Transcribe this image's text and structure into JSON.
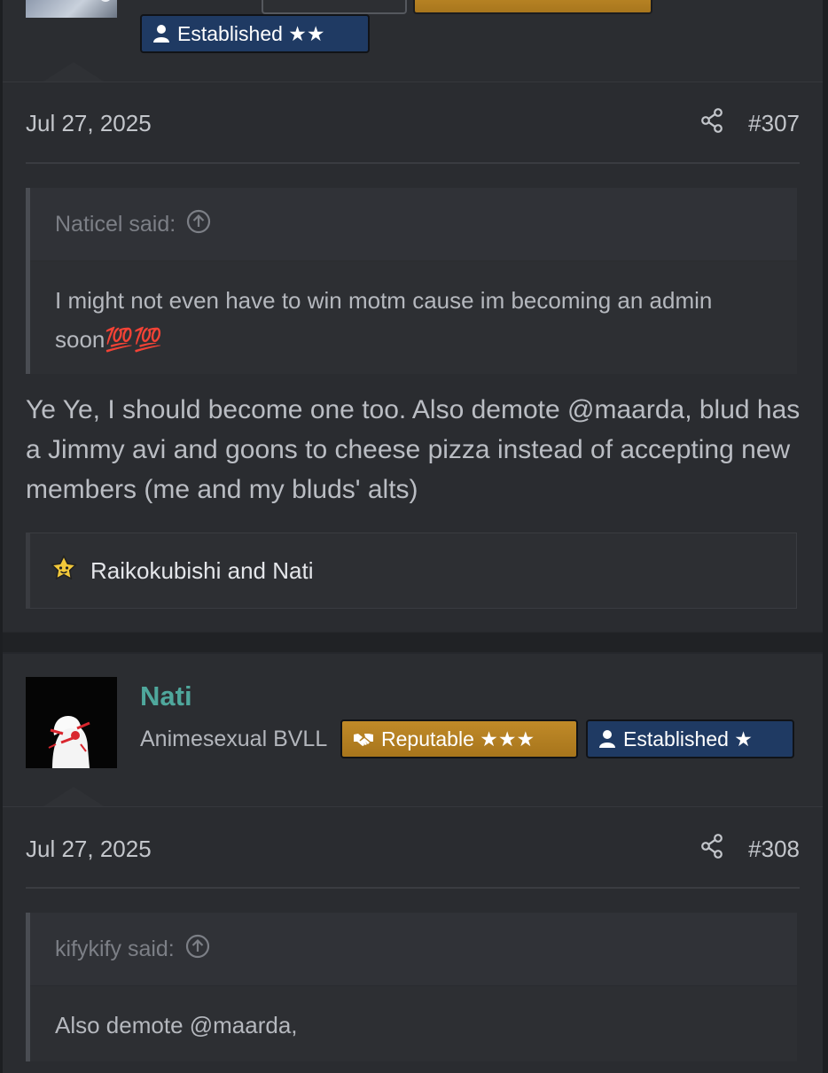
{
  "post_prev": {
    "badge_established": "Established ★★",
    "date": "Jul 27, 2025",
    "post_number": "#307",
    "quote": {
      "author": "Naticel said:",
      "text": "I might not even have to win motm cause im becoming an admin soon💯💯"
    },
    "body": "Ye Ye, I should become one too. Also demote @maarda, blud has a Jimmy avi and goons to cheese pizza instead of accepting new members (me and my bluds' alts)",
    "reactions": "Raikokubishi and Nati"
  },
  "post_next": {
    "username": "Nati",
    "user_title": "Animesexual BVLL",
    "badge_reputable": "Reputable ★★★",
    "badge_established": "Established ★",
    "date": "Jul 27, 2025",
    "post_number": "#308",
    "quote": {
      "author": "kifykify said:",
      "text": "Also demote @maarda,"
    }
  },
  "colors": {
    "background": "#26282c",
    "username": "#4fa79c",
    "badge_blue": "#1f3a63",
    "badge_gold": "#b8831f"
  },
  "icons": [
    "person-icon",
    "share-icon",
    "arrow-up-circle-icon",
    "star-reaction-icon",
    "handshake-icon"
  ]
}
